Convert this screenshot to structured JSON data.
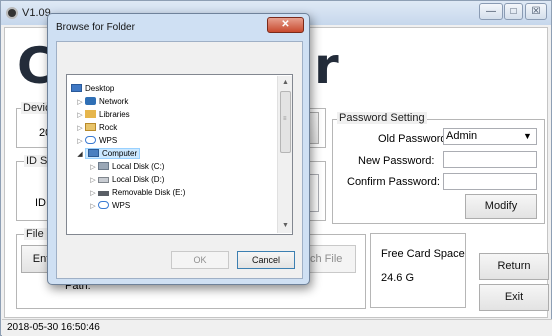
{
  "app": {
    "version": "V1.09",
    "title_left": "C",
    "title_right": "r",
    "minimize": "—",
    "maximize": "□",
    "close": "☒"
  },
  "device_group": {
    "label": "Devic",
    "value": "20"
  },
  "id_group": {
    "label": "ID S",
    "field_label": "ID"
  },
  "file_group": {
    "label": "File (",
    "button": "Ent",
    "path_label": "Path:",
    "search_button": "ch File"
  },
  "password": {
    "label": "Password Setting",
    "old_label": "Old Password",
    "old_value": "Admin",
    "new_label": "New Password:",
    "confirm_label": "Confirm Password:",
    "modify": "Modify"
  },
  "card": {
    "label": "Free Card Space",
    "value": "24.6 G"
  },
  "buttons": {
    "return": "Return",
    "exit": "Exit"
  },
  "status": {
    "timestamp": "2018-05-30 16:50:46"
  },
  "dialog": {
    "title": "Browse for Folder",
    "close": "✕",
    "ok": "OK",
    "cancel": "Cancel",
    "tree": [
      {
        "label": "Desktop",
        "icon": "desktop-icon"
      },
      {
        "label": "Network",
        "icon": "network-icon"
      },
      {
        "label": "Libraries",
        "icon": "libraries-icon"
      },
      {
        "label": "Rock",
        "icon": "user-folder-icon"
      },
      {
        "label": "WPS",
        "icon": "cloud-icon"
      },
      {
        "label": "Computer",
        "icon": "computer-icon"
      },
      {
        "label": "Local Disk (C:)",
        "icon": "system-drive-icon"
      },
      {
        "label": "Local Disk (D:)",
        "icon": "drive-icon"
      },
      {
        "label": "Removable Disk (E:)",
        "icon": "removable-drive-icon"
      },
      {
        "label": "WPS",
        "icon": "cloud-icon"
      }
    ]
  },
  "colors": {
    "selection": "#cce8ff",
    "titlebar": "#c6d7ec",
    "close_red": "#c84a2f"
  }
}
